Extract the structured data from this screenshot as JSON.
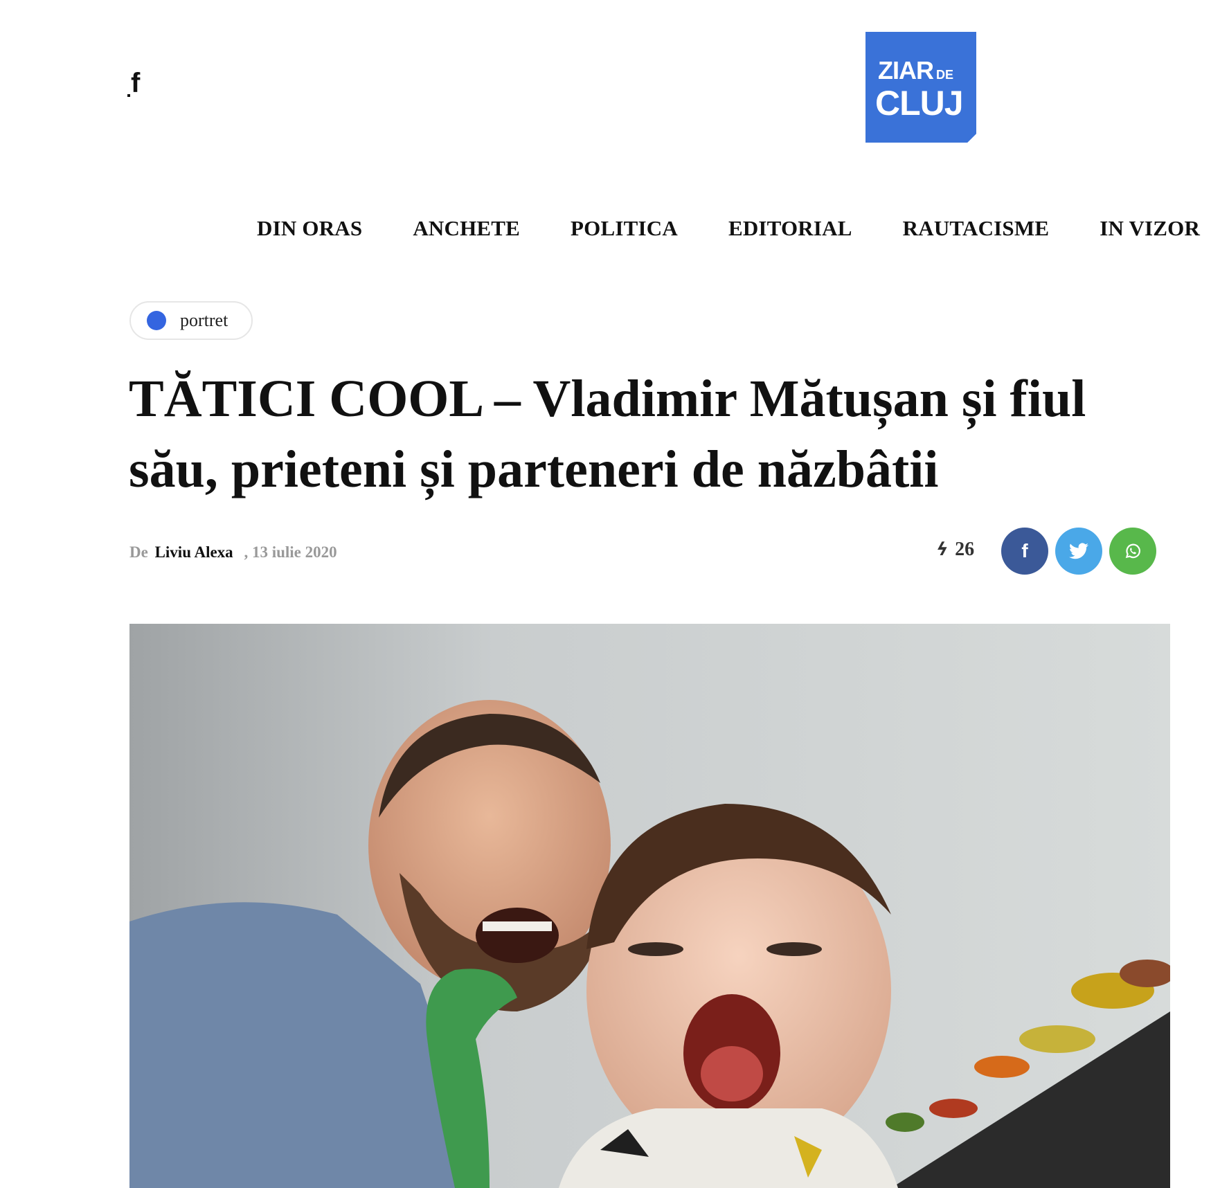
{
  "header": {
    "social_icon": "facebook-icon",
    "social_glyph": "f",
    "logo": {
      "line1": "ZIAR",
      "line1_small": "DE",
      "line2": "CLUJ",
      "color": "#3a72d8"
    }
  },
  "nav": {
    "items": [
      {
        "label": "DIN ORAS"
      },
      {
        "label": "ANCHETE"
      },
      {
        "label": "POLITICA"
      },
      {
        "label": "EDITORIAL"
      },
      {
        "label": "RAUTACISME"
      },
      {
        "label": "IN VIZOR"
      }
    ]
  },
  "article": {
    "category": "portret",
    "category_color": "#3465e0",
    "title": "TĂTICI COOL – Vladimir Mătușan și fiul său, prieteni și parteneri de năzbâtii",
    "by_prefix": "De",
    "author": "Liviu Alexa",
    "date": ", 13 iulie 2020",
    "share_count": "26",
    "share_buttons": [
      {
        "network": "facebook",
        "icon": "facebook-icon",
        "color": "#3b5998"
      },
      {
        "network": "twitter",
        "icon": "twitter-icon",
        "color": "#4aa8e8"
      },
      {
        "network": "whatsapp",
        "icon": "whatsapp-icon",
        "color": "#58b84b"
      }
    ],
    "image": {
      "description_icon": "hero-photo"
    }
  }
}
